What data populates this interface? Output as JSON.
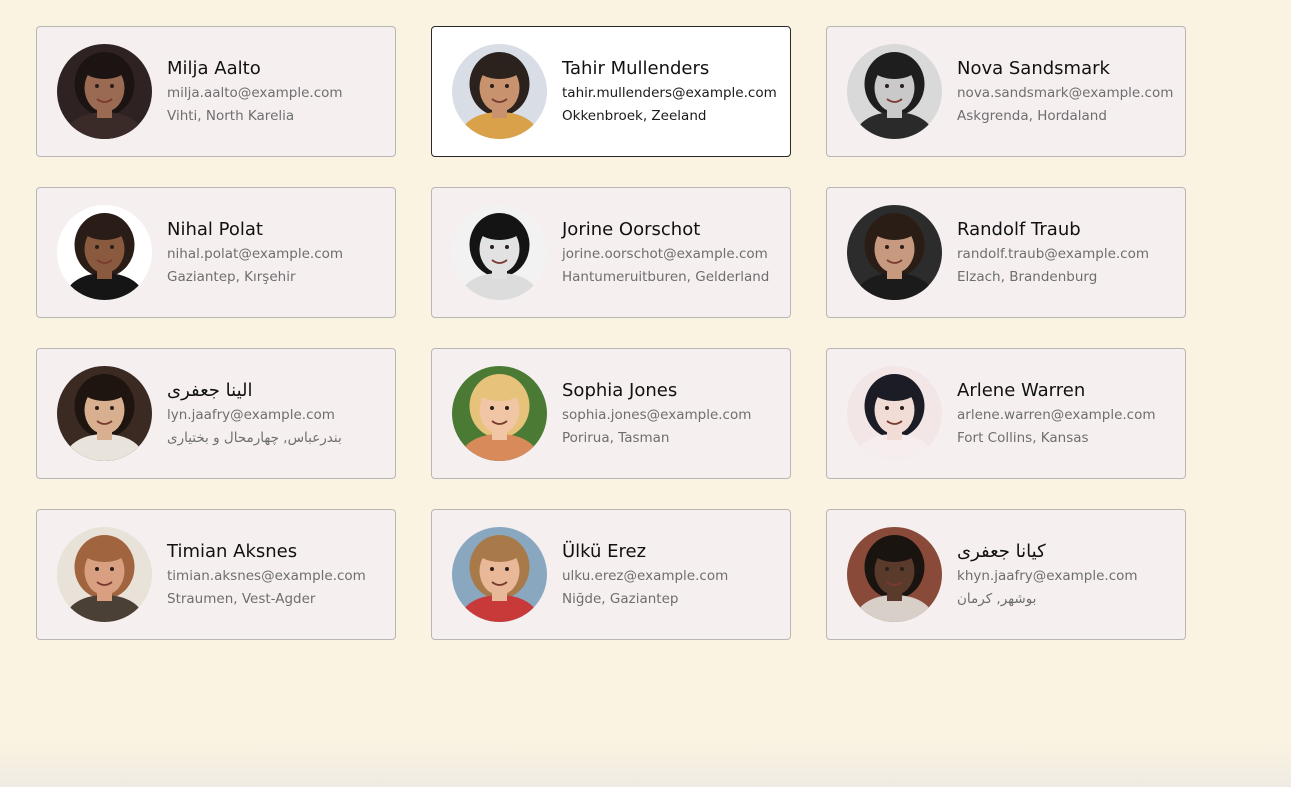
{
  "people": [
    {
      "name": "Milja Aalto",
      "email": "milja.aalto@example.com",
      "location": "Vihti, North Karelia",
      "selected": false,
      "avatar": {
        "bg": "#2e2322",
        "hair": "#1c1412",
        "skin": "#9a6a52",
        "shirt": "#3a2a28"
      }
    },
    {
      "name": "Tahir Mullenders",
      "email": "tahir.mullenders@example.com",
      "location": "Okkenbroek, Zeeland",
      "selected": true,
      "avatar": {
        "bg": "#d8dde6",
        "hair": "#2b221e",
        "skin": "#c8926e",
        "shirt": "#d9a24a"
      }
    },
    {
      "name": "Nova Sandsmark",
      "email": "nova.sandsmark@example.com",
      "location": "Askgrenda, Hordaland",
      "selected": false,
      "avatar": {
        "bg": "#d9d9d9",
        "hair": "#1e1e1e",
        "skin": "#c9c9c9",
        "shirt": "#2a2a2a"
      }
    },
    {
      "name": "Nihal Polat",
      "email": "nihal.polat@example.com",
      "location": "Gaziantep, Kırşehir",
      "selected": false,
      "avatar": {
        "bg": "#ffffff",
        "hair": "#2a1c16",
        "skin": "#8a5a3e",
        "shirt": "#151515"
      }
    },
    {
      "name": "Jorine Oorschot",
      "email": "jorine.oorschot@example.com",
      "location": "Hantumeruitburen, Gelderland",
      "selected": false,
      "avatar": {
        "bg": "#f2f2f2",
        "hair": "#141414",
        "skin": "#e2e2e2",
        "shirt": "#dcdcdc"
      }
    },
    {
      "name": "Randolf Traub",
      "email": "randolf.traub@example.com",
      "location": "Elzach, Brandenburg",
      "selected": false,
      "avatar": {
        "bg": "#2c2c2c",
        "hair": "#2a1d16",
        "skin": "#c79a80",
        "shirt": "#1b1b1b"
      }
    },
    {
      "name": "الينا جعفری",
      "email": "lyn.jaafry@example.com",
      "location": "بندرعباس, چهارمحال و بختیاری",
      "selected": false,
      "avatar": {
        "bg": "#3a2a22",
        "hair": "#1e1410",
        "skin": "#d8b090",
        "shirt": "#e8e4dc"
      }
    },
    {
      "name": "Sophia Jones",
      "email": "sophia.jones@example.com",
      "location": "Porirua, Tasman",
      "selected": false,
      "avatar": {
        "bg": "#4a7a34",
        "hair": "#e6c27a",
        "skin": "#f0c6a4",
        "shirt": "#d88a5a"
      }
    },
    {
      "name": "Arlene Warren",
      "email": "arlene.warren@example.com",
      "location": "Fort Collins, Kansas",
      "selected": false,
      "avatar": {
        "bg": "#f3e6e6",
        "hair": "#1c1c26",
        "skin": "#f2dcd6",
        "shirt": "#f6eeee"
      }
    },
    {
      "name": "Timian Aksnes",
      "email": "timian.aksnes@example.com",
      "location": "Straumen, Vest-Agder",
      "selected": false,
      "avatar": {
        "bg": "#e8e2d8",
        "hair": "#a0643e",
        "skin": "#d8a080",
        "shirt": "#4a4036"
      }
    },
    {
      "name": "Ülkü Erez",
      "email": "ulku.erez@example.com",
      "location": "Niğde, Gaziantep",
      "selected": false,
      "avatar": {
        "bg": "#8aa7c0",
        "hair": "#a87a4a",
        "skin": "#e8b898",
        "shirt": "#c83a3a"
      }
    },
    {
      "name": "کیانا جعفری",
      "email": "khyn.jaafry@example.com",
      "location": "بوشهر, کرمان",
      "selected": false,
      "avatar": {
        "bg": "#8a4a3a",
        "hair": "#1a1410",
        "skin": "#5a3a2a",
        "shirt": "#d8d0c8"
      }
    }
  ]
}
